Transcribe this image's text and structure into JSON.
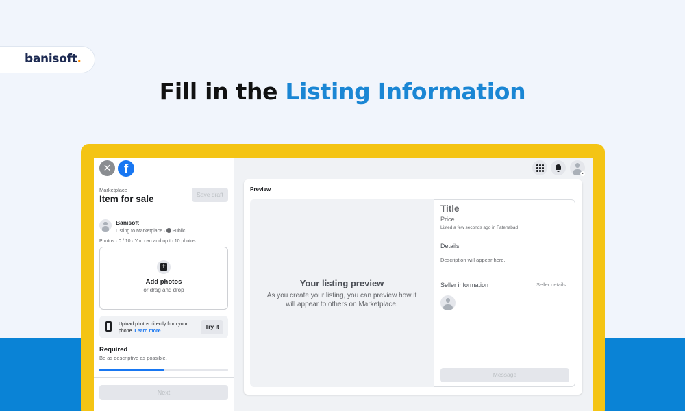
{
  "brand": {
    "name": "banisoft",
    "dot": "."
  },
  "headline": {
    "prefix": "Fill in the ",
    "highlight": "Listing Information"
  },
  "colors": {
    "accent": "#1a86d4",
    "frame": "#f4c414",
    "band": "#0a83d6",
    "facebook_blue": "#1877f2"
  },
  "left_panel": {
    "close_icon": "close-icon",
    "facebook_logo": "f",
    "marketplace_label": "Marketplace",
    "title": "Item for sale",
    "save_draft": "Save draft",
    "user": {
      "name": "Banisoft",
      "subtitle": "Listing to Marketplace · ",
      "audience": "Public"
    },
    "photos_hint": "Photos · 0 / 10 · You can add up to 10 photos.",
    "add_photos": "Add photos",
    "drag_drop": "or drag and drop",
    "upload": {
      "text": "Upload photos directly from your phone. ",
      "link": "Learn more",
      "button": "Try it"
    },
    "required": "Required",
    "required_hint": "Be as descriptive as possible.",
    "progress_percent": 50,
    "next": "Next"
  },
  "top_icons": [
    "grid-icon",
    "bell-icon",
    "account-avatar"
  ],
  "preview": {
    "label": "Preview",
    "placeholder_title": "Your listing preview",
    "placeholder_desc": "As you create your listing, you can preview how it will appear to others on Marketplace.",
    "details": {
      "title": "Title",
      "price": "Price",
      "listed": "Listed a few seconds ago in Fatehabad",
      "details_heading": "Details",
      "description": "Description will appear here.",
      "seller_heading": "Seller information",
      "seller_details": "Seller details",
      "message": "Message"
    }
  }
}
